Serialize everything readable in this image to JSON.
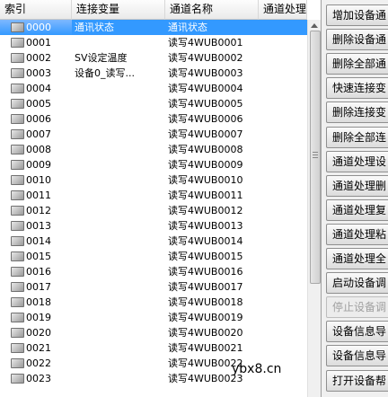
{
  "table": {
    "columns": [
      "索引",
      "连接变量",
      "通道名称",
      "通道处理"
    ],
    "rows": [
      {
        "index": "0000",
        "variable": "通讯状态",
        "channel": "通讯状态",
        "selected": true
      },
      {
        "index": "0001",
        "variable": "",
        "channel": "读写4WUB0001"
      },
      {
        "index": "0002",
        "variable": "SV设定温度",
        "channel": "读写4WUB0002"
      },
      {
        "index": "0003",
        "variable": "设备0_读写...",
        "channel": "读写4WUB0003"
      },
      {
        "index": "0004",
        "variable": "",
        "channel": "读写4WUB0004"
      },
      {
        "index": "0005",
        "variable": "",
        "channel": "读写4WUB0005"
      },
      {
        "index": "0006",
        "variable": "",
        "channel": "读写4WUB0006"
      },
      {
        "index": "0007",
        "variable": "",
        "channel": "读写4WUB0007"
      },
      {
        "index": "0008",
        "variable": "",
        "channel": "读写4WUB0008"
      },
      {
        "index": "0009",
        "variable": "",
        "channel": "读写4WUB0009"
      },
      {
        "index": "0010",
        "variable": "",
        "channel": "读写4WUB0010"
      },
      {
        "index": "0011",
        "variable": "",
        "channel": "读写4WUB0011"
      },
      {
        "index": "0012",
        "variable": "",
        "channel": "读写4WUB0012"
      },
      {
        "index": "0013",
        "variable": "",
        "channel": "读写4WUB0013"
      },
      {
        "index": "0014",
        "variable": "",
        "channel": "读写4WUB0014"
      },
      {
        "index": "0015",
        "variable": "",
        "channel": "读写4WUB0015"
      },
      {
        "index": "0016",
        "variable": "",
        "channel": "读写4WUB0016"
      },
      {
        "index": "0017",
        "variable": "",
        "channel": "读写4WUB0017"
      },
      {
        "index": "0018",
        "variable": "",
        "channel": "读写4WUB0018"
      },
      {
        "index": "0019",
        "variable": "",
        "channel": "读写4WUB0019"
      },
      {
        "index": "0020",
        "variable": "",
        "channel": "读写4WUB0020"
      },
      {
        "index": "0021",
        "variable": "",
        "channel": "读写4WUB0021"
      },
      {
        "index": "0022",
        "variable": "",
        "channel": "读写4WUB0022"
      },
      {
        "index": "0023",
        "variable": "",
        "channel": "读写4WUB0023"
      }
    ]
  },
  "buttons": [
    {
      "label": "增加设备通",
      "enabled": true
    },
    {
      "label": "删除设备通",
      "enabled": true
    },
    {
      "label": "删除全部通",
      "enabled": true
    },
    {
      "label": "快速连接变",
      "enabled": true
    },
    {
      "label": "删除连接变",
      "enabled": true
    },
    {
      "label": "删除全部连",
      "enabled": true
    },
    {
      "label": "通道处理设",
      "enabled": true
    },
    {
      "label": "通道处理删",
      "enabled": true
    },
    {
      "label": "通道处理复",
      "enabled": true
    },
    {
      "label": "通道处理粘",
      "enabled": true
    },
    {
      "label": "通道处理全",
      "enabled": true
    },
    {
      "label": "启动设备调",
      "enabled": true
    },
    {
      "label": "停止设备调",
      "enabled": false
    },
    {
      "label": "设备信息导",
      "enabled": true
    },
    {
      "label": "设备信息导",
      "enabled": true
    },
    {
      "label": "打开设备帮",
      "enabled": true
    }
  ],
  "watermark": "ybx8.cn",
  "colors": {
    "selection": "#3399ff",
    "background": "#f0f0f0"
  }
}
